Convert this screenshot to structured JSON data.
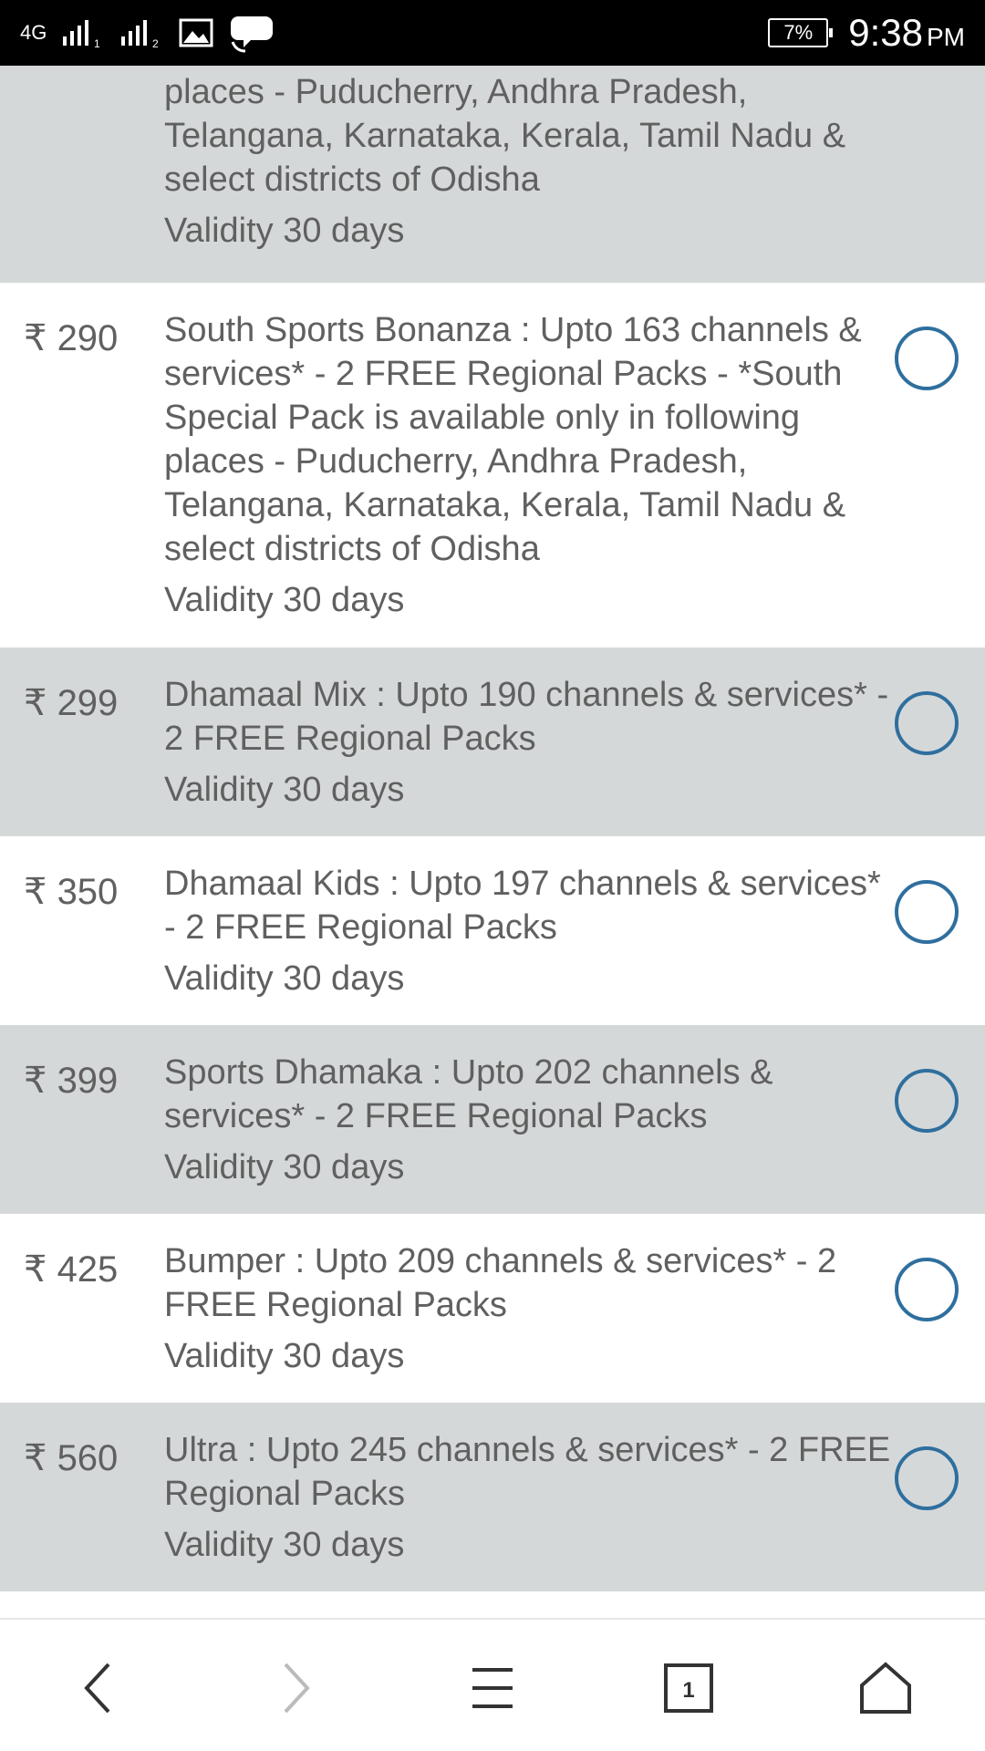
{
  "status_bar": {
    "network": "4G",
    "sim1": "1",
    "sim2": "2",
    "battery": "7%",
    "time": "9:38",
    "ampm": "PM"
  },
  "plans": [
    {
      "price": "",
      "description": "places - Puducherry, Andhra Pradesh, Telangana, Karnataka, Kerala, Tamil Nadu & select districts of Odisha",
      "validity": "Validity 30 days"
    },
    {
      "price": "₹ 290",
      "description": "South Sports Bonanza : Upto 163 channels & services* - 2 FREE Regional Packs - *South Special Pack is available only in following places - Puducherry, Andhra Pradesh, Telangana, Karnataka, Kerala, Tamil Nadu & select districts of Odisha",
      "validity": "Validity 30 days"
    },
    {
      "price": "₹ 299",
      "description": "Dhamaal Mix : Upto 190 channels & services* - 2 FREE Regional Packs",
      "validity": "Validity 30 days"
    },
    {
      "price": "₹ 350",
      "description": "Dhamaal Kids : Upto 197 channels & services* - 2 FREE Regional Packs",
      "validity": "Validity 30 days"
    },
    {
      "price": "₹ 399",
      "description": "Sports Dhamaka : Upto 202 channels & services* - 2 FREE Regional Packs",
      "validity": "Validity 30 days"
    },
    {
      "price": "₹ 425",
      "description": "Bumper : Upto 209 channels & services* - 2 FREE Regional Packs",
      "validity": "Validity 30 days"
    },
    {
      "price": "₹ 560",
      "description": "Ultra : Upto 245 channels & services* - 2 FREE Regional Packs",
      "validity": "Validity 30 days"
    }
  ],
  "bottom_nav": {
    "tab_count": "1",
    "icons": [
      "back-icon",
      "forward-icon",
      "menu-icon",
      "tabs-icon",
      "home-icon"
    ]
  },
  "colors": {
    "row_grey": "#d5d8d9",
    "text": "#606060",
    "radio_border": "#2f6f9e"
  }
}
